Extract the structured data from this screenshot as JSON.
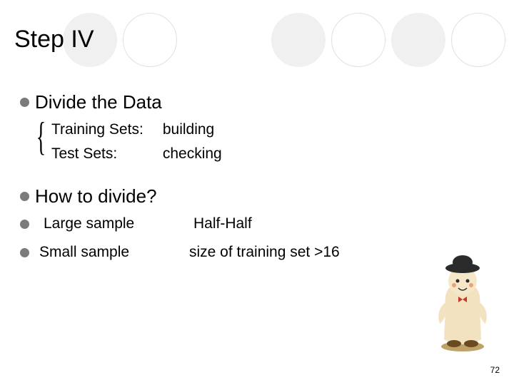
{
  "title": "Step IV",
  "bullets": {
    "divide": "Divide the Data",
    "sub1_label": "Training Sets:",
    "sub1_val": "building",
    "sub2_label": "Test Sets:",
    "sub2_val": "checking",
    "howto": "How to divide?",
    "large_label": "Large sample",
    "large_val": "Half-Half",
    "small_label": "Small sample",
    "small_val": "size of training set >16"
  },
  "page_number": "72"
}
